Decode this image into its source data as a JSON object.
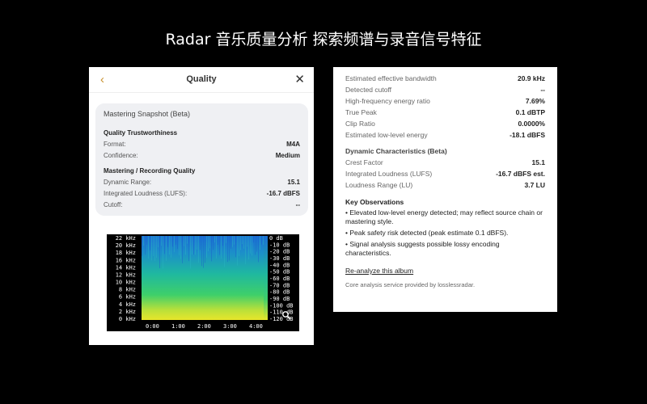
{
  "headline": "Radar 音乐质量分析 探索频谱与录音信号特征",
  "left_panel": {
    "back_icon": "chevron-left-icon",
    "title": "Quality",
    "close_icon": "close-icon",
    "snapshot": {
      "title": "Mastering Snapshot (Beta)",
      "trust_title": "Quality Trustworthiness",
      "format_label": "Format:",
      "format_value": "M4A",
      "confidence_label": "Confidence:",
      "confidence_value": "Medium",
      "mastering_title": "Mastering / Recording Quality",
      "dr_label": "Dynamic Range:",
      "dr_value": "15.1",
      "lufs_label": "Integrated Loudness (LUFS):",
      "lufs_value": "-16.7 dBFS",
      "cutoff_label": "Cutoff:",
      "cutoff_value": "--"
    },
    "spectrogram": {
      "freq_labels": [
        "22 kHz",
        "20 kHz",
        "18 kHz",
        "16 kHz",
        "14 kHz",
        "12 kHz",
        "10 kHz",
        "8 kHz",
        "6 kHz",
        "4 kHz",
        "2 kHz",
        "0 kHz"
      ],
      "db_labels": [
        "0 dB",
        "-10 dB",
        "-20 dB",
        "-30 dB",
        "-40 dB",
        "-50 dB",
        "-60 dB",
        "-70 dB",
        "-80 dB",
        "-90 dB",
        "-100 dB",
        "-110 dB",
        "-120 dB"
      ],
      "time_labels": [
        "0:00",
        "1:00",
        "2:00",
        "3:00",
        "4:00"
      ],
      "zoom_icon": "magnifier-icon"
    }
  },
  "right_panel": {
    "metrics": [
      {
        "label": "Estimated effective bandwidth",
        "value": "20.9 kHz"
      },
      {
        "label": "Detected cutoff",
        "value": "--"
      },
      {
        "label": "High-frequency energy ratio",
        "value": "7.69%"
      },
      {
        "label": "True Peak",
        "value": "0.1 dBTP"
      },
      {
        "label": "Clip Ratio",
        "value": "0.0000%"
      },
      {
        "label": "Estimated low-level energy",
        "value": "-18.1 dBFS"
      }
    ],
    "dynamic_title": "Dynamic Characteristics (Beta)",
    "dynamic": [
      {
        "label": "Crest Factor",
        "value": "15.1"
      },
      {
        "label": "Integrated Loudness (LUFS)",
        "value": "-16.7 dBFS est."
      },
      {
        "label": "Loudness Range (LU)",
        "value": "3.7 LU"
      }
    ],
    "observations_title": "Key Observations",
    "observations": [
      "• Elevated low-level energy detected; may reflect source chain or mastering style.",
      "• Peak safety risk detected (peak estimate 0.1 dBFS).",
      "• Signal analysis suggests possible lossy encoding characteristics."
    ],
    "reanalyze_label": "Re-analyze this album",
    "footer": "Core analysis service provided by losslessradar."
  }
}
